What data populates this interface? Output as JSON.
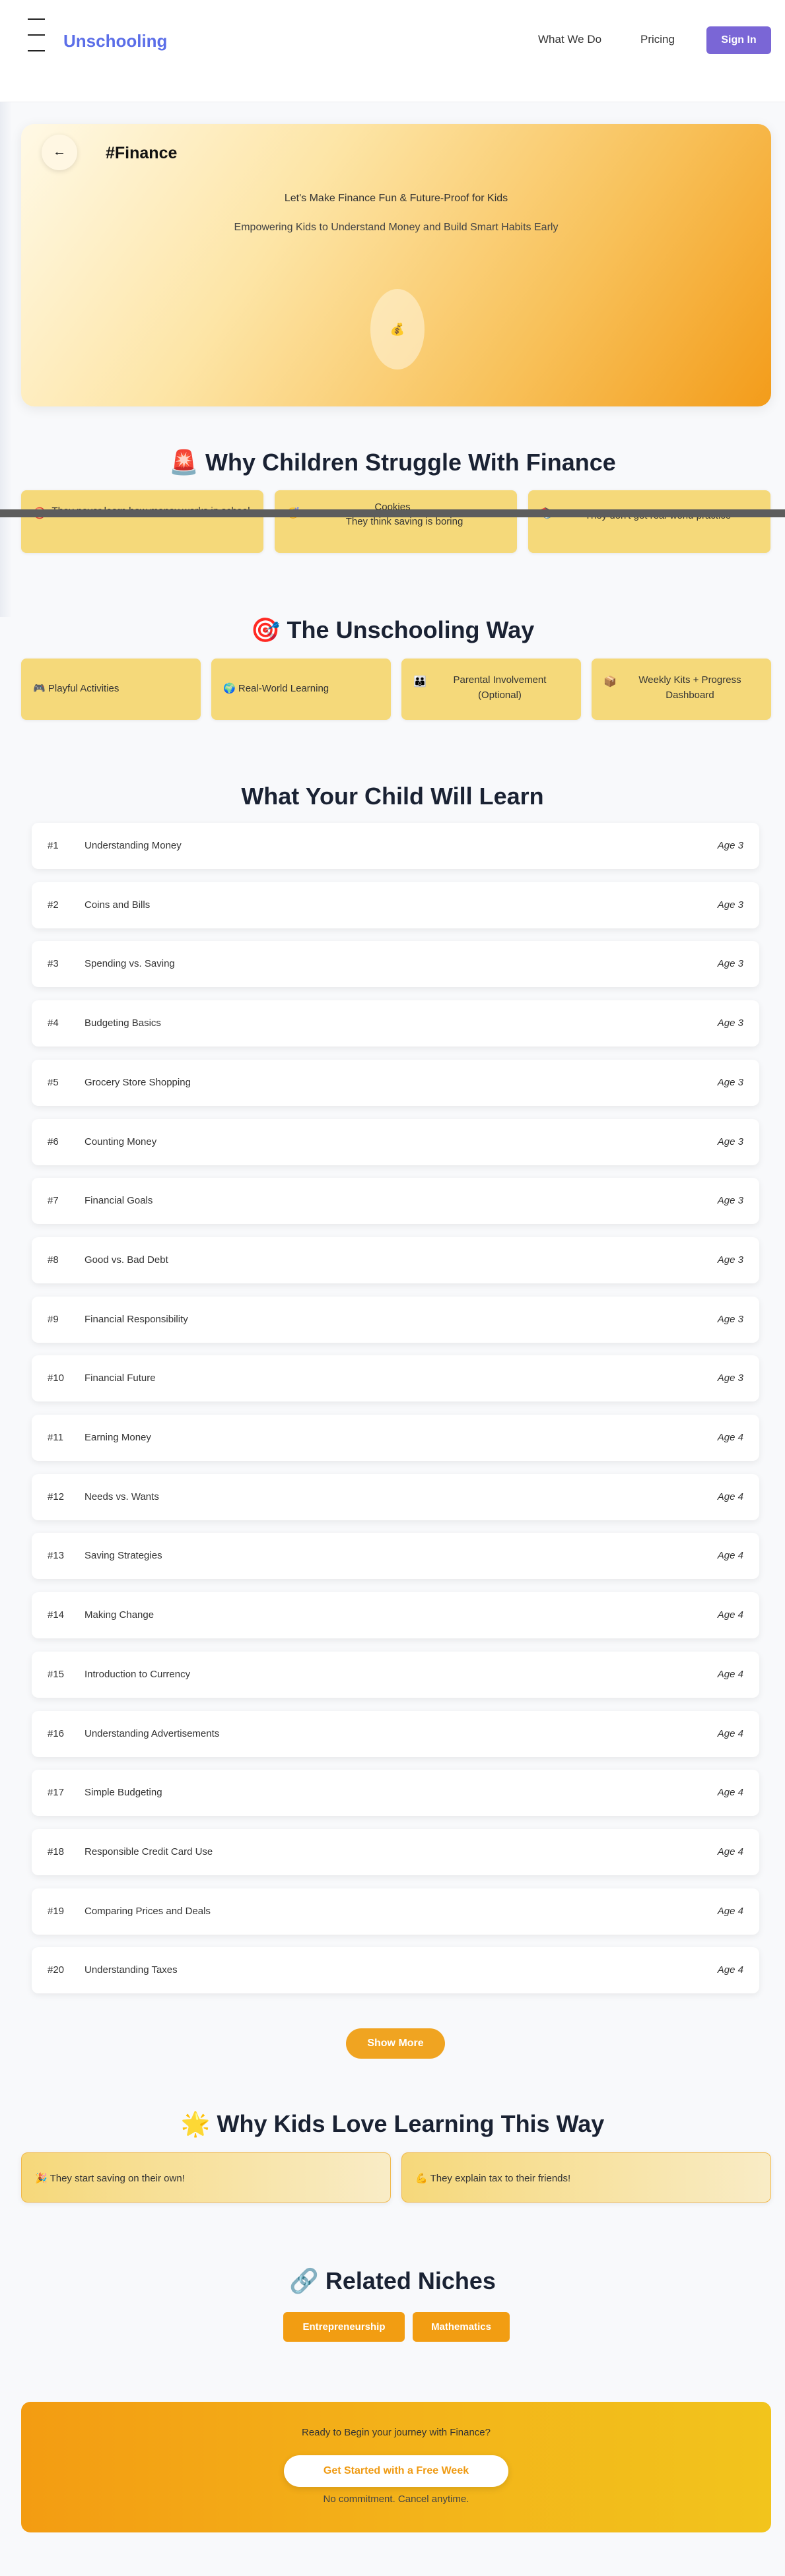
{
  "header": {
    "logo": "Unschooling",
    "nav": [
      "What We Do",
      "Pricing"
    ],
    "sign_in": "Sign In"
  },
  "hero": {
    "back_icon": "arrow-left-icon",
    "back_symbol": "←",
    "title": "#Finance",
    "subtitle": "Let's Make Finance Fun & Future-Proof for Kids",
    "description": "Empowering Kids to Understand Money and Build Smart Habits Early",
    "badge": "💰"
  },
  "struggle": {
    "title": "🚨 Why Children Struggle With Finance",
    "overlay_label": "Cookies",
    "cards": [
      {
        "icon": "🚫",
        "text": "They never learn how money works in school"
      },
      {
        "icon": "😴",
        "text": "They think saving is boring"
      },
      {
        "icon": "📚",
        "text": "They don't get real-world practice"
      }
    ]
  },
  "way": {
    "title": "🎯 The Unschooling Way",
    "cards": [
      {
        "icon": "🎮",
        "text": "Playful Activities"
      },
      {
        "icon": "🌍",
        "text": "Real-World Learning"
      },
      {
        "icon": "👪",
        "text": "Parental Involvement (Optional)"
      },
      {
        "icon": "📦",
        "text": "Weekly Kits + Progress Dashboard"
      }
    ]
  },
  "learn": {
    "title": "What Your Child Will Learn",
    "lessons": [
      {
        "num": "#1",
        "name": "Understanding Money",
        "age": "Age 3"
      },
      {
        "num": "#2",
        "name": "Coins and Bills",
        "age": "Age 3"
      },
      {
        "num": "#3",
        "name": "Spending vs. Saving",
        "age": "Age 3"
      },
      {
        "num": "#4",
        "name": "Budgeting Basics",
        "age": "Age 3"
      },
      {
        "num": "#5",
        "name": "Grocery Store Shopping",
        "age": "Age 3"
      },
      {
        "num": "#6",
        "name": "Counting Money",
        "age": "Age 3"
      },
      {
        "num": "#7",
        "name": "Financial Goals",
        "age": "Age 3"
      },
      {
        "num": "#8",
        "name": "Good vs. Bad Debt",
        "age": "Age 3"
      },
      {
        "num": "#9",
        "name": "Financial Responsibility",
        "age": "Age 3"
      },
      {
        "num": "#10",
        "name": "Financial Future",
        "age": "Age 3"
      },
      {
        "num": "#11",
        "name": "Earning Money",
        "age": "Age 4"
      },
      {
        "num": "#12",
        "name": "Needs vs. Wants",
        "age": "Age 4"
      },
      {
        "num": "#13",
        "name": "Saving Strategies",
        "age": "Age 4"
      },
      {
        "num": "#14",
        "name": "Making Change",
        "age": "Age 4"
      },
      {
        "num": "#15",
        "name": "Introduction to Currency",
        "age": "Age 4"
      },
      {
        "num": "#16",
        "name": "Understanding Advertisements",
        "age": "Age 4"
      },
      {
        "num": "#17",
        "name": "Simple Budgeting",
        "age": "Age 4"
      },
      {
        "num": "#18",
        "name": "Responsible Credit Card Use",
        "age": "Age 4"
      },
      {
        "num": "#19",
        "name": "Comparing Prices and Deals",
        "age": "Age 4"
      },
      {
        "num": "#20",
        "name": "Understanding Taxes",
        "age": "Age 4"
      }
    ],
    "show_more": "Show More"
  },
  "love": {
    "title": "🌟 Why Kids Love Learning This Way",
    "cards": [
      {
        "text": "🎉 They start saving on their own!"
      },
      {
        "text": "💪 They explain tax to their friends!"
      }
    ]
  },
  "related": {
    "title": "🔗 Related Niches",
    "niches": [
      "Entrepreneurship",
      "Mathematics"
    ]
  },
  "cta": {
    "question": "Ready to Begin your journey with Finance?",
    "button": "Get Started with a Free Week",
    "note": "No commitment. Cancel anytime."
  }
}
